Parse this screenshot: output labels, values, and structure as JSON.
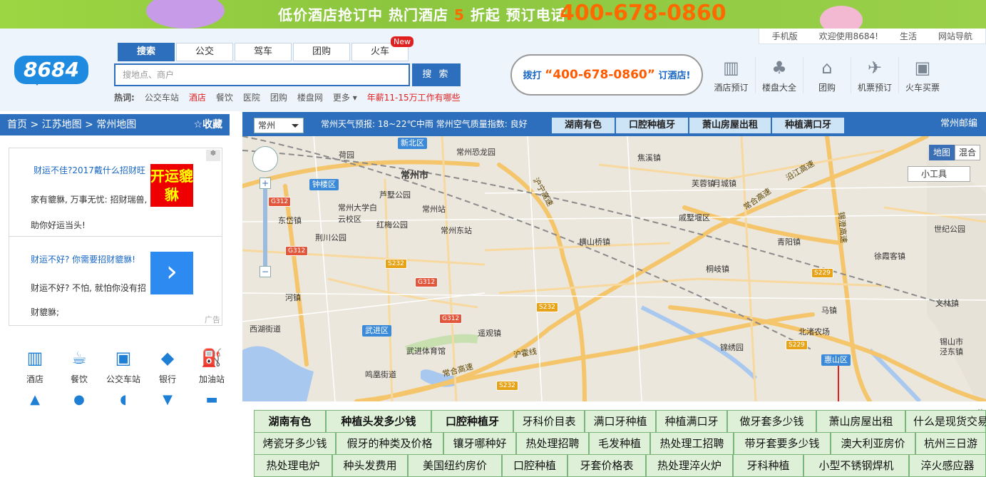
{
  "banner": {
    "text": "低价酒店抢订中 热门酒店",
    "discount_num": "5",
    "text2": "折起 预订电话",
    "phone": "400-678-0860"
  },
  "toplinks": [
    "手机版",
    "欢迎使用8684!",
    "生活",
    "网站导航"
  ],
  "logo": "8684",
  "search": {
    "tabs": [
      "搜索",
      "公交",
      "驾车",
      "团购",
      "火车"
    ],
    "new_badge": "New",
    "placeholder": "搜地点、商户",
    "button": "搜 索",
    "hot_label": "热词:",
    "hot_words": [
      "公交车站",
      "酒店",
      "餐饮",
      "医院",
      "团购",
      "楼盘网",
      "更多"
    ],
    "hot_promo": "年薪11-15万工作有哪些"
  },
  "callout": {
    "prefix": "拨打",
    "phone": "“400-678-0860”",
    "suffix": "订酒店!"
  },
  "quick_links": [
    {
      "label": "酒店预订",
      "icon": "building-icon"
    },
    {
      "label": "楼盘大全",
      "icon": "palm-tree-icon"
    },
    {
      "label": "团购",
      "icon": "basket-icon"
    },
    {
      "label": "机票预订",
      "icon": "airplane-icon"
    },
    {
      "label": "火车买票",
      "icon": "train-icon"
    }
  ],
  "breadcrumb": {
    "path": "首页 > 江苏地图 > 常州地图",
    "favorite": "☆收藏"
  },
  "ads": [
    {
      "title": "财运不佳?2017戴什么招财旺",
      "desc": "家有貔貅, 万事无忧: 招财瑞兽, 助你好运当头!",
      "img_text": "开运貔貅"
    },
    {
      "title": "财运不好? 你需要招财貔貅!",
      "desc": "财运不好? 不怕, 就怕你没有招财貔貅;",
      "img_text": "›"
    }
  ],
  "ad_label": "广告",
  "categories": [
    {
      "label": "酒店",
      "icon": "hotel-icon"
    },
    {
      "label": "餐饮",
      "icon": "drink-icon"
    },
    {
      "label": "公交车站",
      "icon": "bus-icon"
    },
    {
      "label": "银行",
      "icon": "bank-icon"
    },
    {
      "label": "加油站",
      "icon": "gas-station-icon"
    }
  ],
  "map_toolbar": {
    "city": "常州",
    "weather": "常州天气预报: 18~22℃中雨 常州空气质量指数: 良好",
    "tabs": [
      "湖南有色",
      "口腔种植牙",
      "萧山房屋出租",
      "种植满口牙"
    ],
    "postcode": "常州邮编"
  },
  "map": {
    "type_buttons": [
      "地图",
      "混合"
    ],
    "tool": "小工具",
    "place_labels": [
      "常州市",
      "新北区",
      "荷园",
      "常州恐龙园",
      "钟楼区",
      "芦墅公园",
      "常州站",
      "常州东站",
      "常州大学白云校区",
      "东岱镇",
      "红梅公园",
      "荆川公园",
      "河镇",
      "西湖街道",
      "武进区",
      "武进体育馆",
      "鸣凰街道",
      "遥观镇",
      "横山桥镇",
      "焦溪镇",
      "戚墅堰区",
      "芙蓉镇",
      "青阳镇",
      "桐岐镇",
      "徐霞客镇",
      "马镇",
      "北渚农场",
      "锦绣园",
      "惠山区",
      "文林镇",
      "锡山市",
      "泾东镇",
      "世纪公园",
      "月城镇"
    ],
    "road_labels": [
      "沪宁高速",
      "沿江高速",
      "常合高速",
      "沪霍线",
      "锡澄高速",
      "常合高速"
    ],
    "shields": [
      "G312",
      "G312",
      "G312",
      "G312",
      "S232",
      "S232",
      "S232",
      "S229",
      "S229"
    ]
  },
  "keywords": [
    [
      "湖南有色",
      "种植头发多少钱",
      "口腔种植牙",
      "牙科价目表",
      "满口牙种植",
      "种植满口牙",
      "做牙套多少钱",
      "萧山房屋出租",
      "什么是现货交易"
    ],
    [
      "烤瓷牙多少钱",
      "假牙的种类及价格",
      "镶牙哪种好",
      "热处理招聘",
      "毛发种植",
      "热处理工招聘",
      "带牙套要多少钱",
      "澳大利亚房价",
      "杭州三日游"
    ],
    [
      "热处理电炉",
      "种头发费用",
      "美国纽约房价",
      "口腔种植",
      "牙套价格表",
      "热处理淬火炉",
      "牙科种植",
      "小型不锈钢焊机",
      "淬火感应器"
    ]
  ]
}
